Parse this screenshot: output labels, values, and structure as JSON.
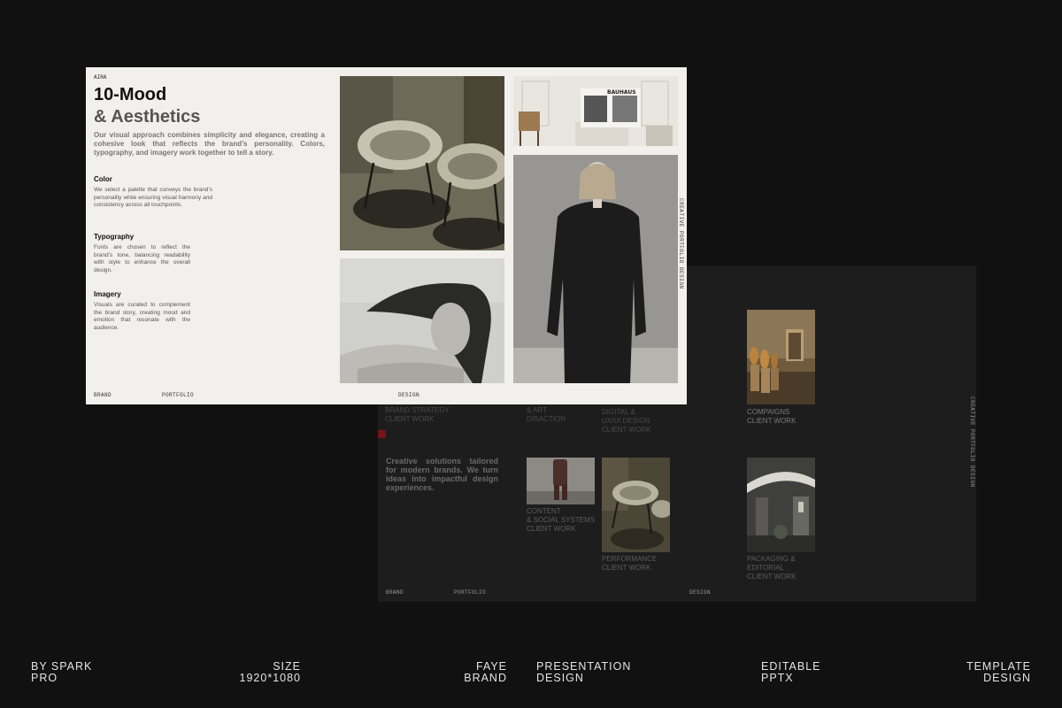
{
  "back_slide": {
    "projects": [
      {
        "line1": "BRAND STRATEGY",
        "line2": "CLIENT WORK",
        "line3": ""
      },
      {
        "line1": "& ART",
        "line2": "DIRACTION",
        "line3": ""
      },
      {
        "line1": "DIGITAL &",
        "line2": "UX/UI DESIGN",
        "line3": "CLIENT WORK"
      },
      {
        "line1": "COMPAIGNS",
        "line2": "CLIENT WORK",
        "line3": ""
      },
      {
        "line1": "CONTENT",
        "line2": "& SOCIAL SYSTEMS",
        "line3": "CLIENT WORK"
      },
      {
        "line1": "PERFORMANCE",
        "line2": "CLIENT WORK",
        "line3": ""
      },
      {
        "line1": "PACKAGING &",
        "line2": "EDITORIAL",
        "line3": "CLIENT WORK"
      }
    ],
    "tagline": "Creative solutions tailored for modern brands. We turn ideas into impactful design experiences.",
    "footer": {
      "brand": "BRAND",
      "portfolio": "PORTFOLIO",
      "design": "DESIGN"
    },
    "side_text": "CREATIVE PORTFOLIO DESIGN",
    "marker_color": "#7a1218"
  },
  "front_slide": {
    "label": "AIRA",
    "title_line1": "10-Mood",
    "title_line2": "& Aesthetics",
    "intro": "Our visual approach combines simplicity and elegance, creating a cohesive look that reflects the brand’s personality. Colors, typography, and imagery work together to tell a story.",
    "sections": [
      {
        "heading": "Color",
        "body": "We select a palette that conveys the brand’s personality while ensuring visual harmony and consistency across all touchpoints."
      },
      {
        "heading": "Typography",
        "body": "Fonts are chosen to reflect the brand’s tone, balancing readability with style to enhance the overall design."
      },
      {
        "heading": "Imagery",
        "body": "Visuals are curated to complement the brand story, creating mood and emotion that resonate with the audience."
      }
    ],
    "footer": {
      "brand": "BRAND",
      "portfolio": "PORTFOLIO",
      "design": "DESIGN"
    },
    "side_text": "CREATIVE PORTFOLIO DESIGN",
    "magazine_text": "BAUHAUS"
  },
  "bottom_bar": [
    {
      "line1": "BY SPARK",
      "line2": "PRO"
    },
    {
      "line1": "SIZE",
      "line2": "1920*1080"
    },
    {
      "line1": "FAYE",
      "line2": "BRAND"
    },
    {
      "line1": "PRESENTATION",
      "line2": "DESIGN"
    },
    {
      "line1": "EDITABLE",
      "line2": "PPTX"
    },
    {
      "line1": "TEMPLATE",
      "line2": "DESIGN"
    }
  ]
}
